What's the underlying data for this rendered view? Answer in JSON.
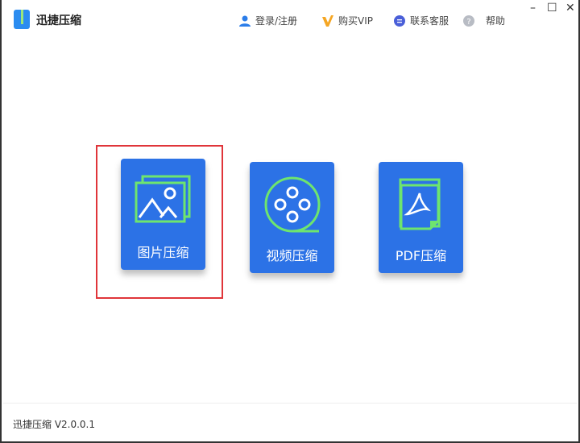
{
  "app": {
    "title": "迅捷压缩",
    "version_label": "迅捷压缩 V2.0.0.1"
  },
  "header": {
    "login": "登录/注册",
    "vip": "购买VIP",
    "support": "联系客服",
    "help": "帮助"
  },
  "window_controls": {
    "minimize": "–",
    "maximize": "☐",
    "close": "✕"
  },
  "cards": [
    {
      "label": "图片压缩",
      "selected": true
    },
    {
      "label": "视频压缩"
    },
    {
      "label": "PDF压缩"
    }
  ],
  "colors": {
    "card": "#2c72e6",
    "accent": "#6ee56e",
    "selection": "#e0353a"
  }
}
